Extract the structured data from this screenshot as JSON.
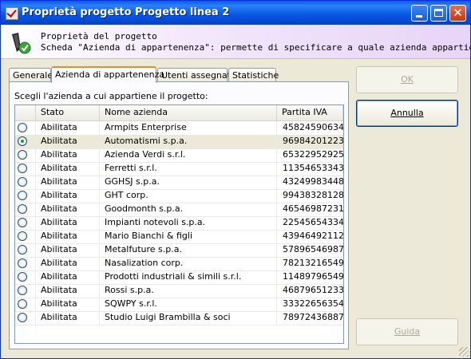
{
  "window": {
    "title": "Proprietà progetto Progetto linea 2",
    "controls": {
      "minimize": "minimize",
      "maximize": "maximize",
      "close": "close"
    }
  },
  "header": {
    "title": "Proprietà del progetto",
    "description": "Scheda \"Azienda di appartenenza\": permette di specificare a quale azienda appartiene il p",
    "icon": "project-properties-icon"
  },
  "tabs": [
    {
      "label": "Generale",
      "active": false
    },
    {
      "label": "Azienda di appartenenza",
      "active": true
    },
    {
      "label": "Utenti assegnati",
      "active": false
    },
    {
      "label": "Statistiche",
      "active": false
    }
  ],
  "panel": {
    "instruction": "Scegli l'azienda a cui appartiene il progetto:"
  },
  "grid": {
    "columns": [
      "Stato",
      "Nome azienda",
      "Partita IVA"
    ],
    "rows": [
      {
        "stato": "Abilitata",
        "nome": "Armpits Enterprise",
        "piva": "45824590634...",
        "selected": false
      },
      {
        "stato": "Abilitata",
        "nome": "Automatismi s.p.a.",
        "piva": "96984201223...",
        "selected": true
      },
      {
        "stato": "Abilitata",
        "nome": "Azienda Verdi s.r.l.",
        "piva": "65322952925...",
        "selected": false
      },
      {
        "stato": "Abilitata",
        "nome": "Ferretti s.r.l.",
        "piva": "11354653343...",
        "selected": false
      },
      {
        "stato": "Abilitata",
        "nome": "GGHSJ s.p.a.",
        "piva": "43249983448...",
        "selected": false
      },
      {
        "stato": "Abilitata",
        "nome": "GHT corp.",
        "piva": "99438328128...",
        "selected": false
      },
      {
        "stato": "Abilitata",
        "nome": "Goodmonth s.p.a.",
        "piva": "46546987231...",
        "selected": false
      },
      {
        "stato": "Abilitata",
        "nome": "Impianti notevoli s.p.a.",
        "piva": "22545654334...",
        "selected": false
      },
      {
        "stato": "Abilitata",
        "nome": "Mario Bianchi & figli",
        "piva": "43946492112...",
        "selected": false
      },
      {
        "stato": "Abilitata",
        "nome": "Metalfuture s.p.a.",
        "piva": "57896546987...",
        "selected": false
      },
      {
        "stato": "Abilitata",
        "nome": "Nasalization corp.",
        "piva": "78213216549...",
        "selected": false
      },
      {
        "stato": "Abilitata",
        "nome": "Prodotti industriali & simili s.r.l.",
        "piva": "11489796549...",
        "selected": false
      },
      {
        "stato": "Abilitata",
        "nome": "Rossi s.p.a.",
        "piva": "46879651233...",
        "selected": false
      },
      {
        "stato": "Abilitata",
        "nome": "SQWPY s.r.l.",
        "piva": "33322656354...",
        "selected": false
      },
      {
        "stato": "Abilitata",
        "nome": "Studio Luigi Brambilla & soci",
        "piva": "78972436887...",
        "selected": false
      }
    ]
  },
  "buttons": {
    "ok": {
      "label": "OK",
      "enabled": false
    },
    "cancel": {
      "label": "Annulla",
      "enabled": true
    },
    "help": {
      "label": "Guida",
      "enabled": false
    }
  },
  "colors": {
    "title_bar": "#0a5ae8",
    "selected_radio": "#21a121",
    "active_tab_accent": "#e68b2c"
  }
}
